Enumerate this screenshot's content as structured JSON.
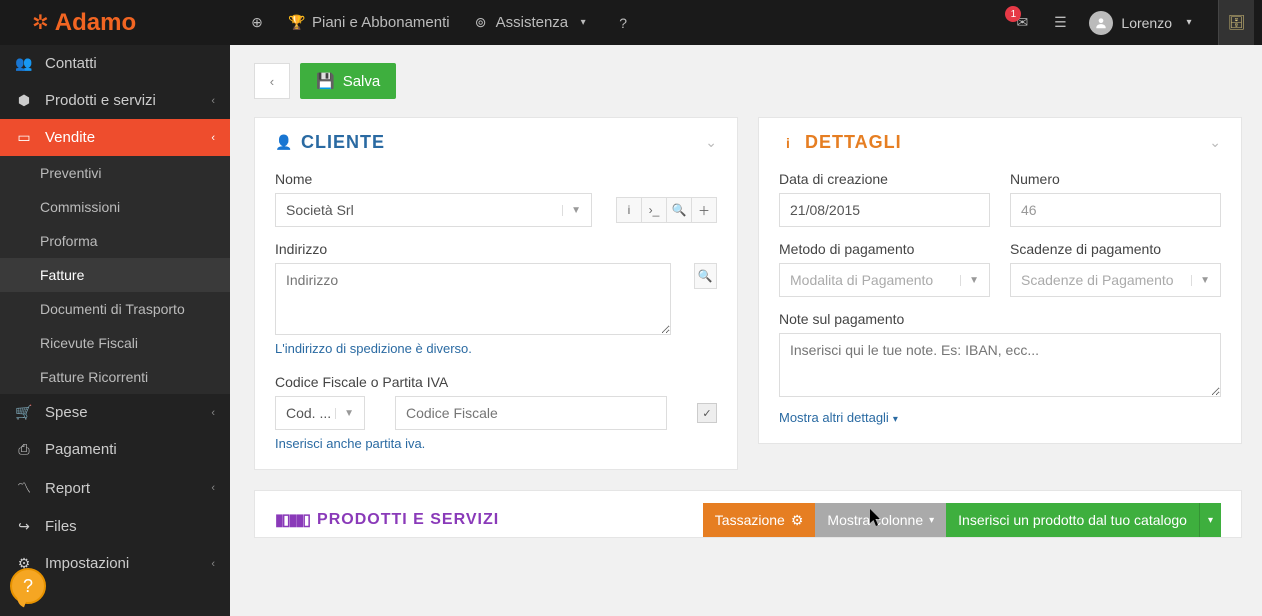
{
  "brand": "Adamo",
  "topnav": {
    "plans": "Piani e Abbonamenti",
    "support": "Assistenza",
    "notifications_count": "1",
    "user_name": "Lorenzo"
  },
  "sidebar": {
    "contatti": "Contatti",
    "prodotti": "Prodotti e servizi",
    "vendite": "Vendite",
    "vendite_sub": {
      "preventivi": "Preventivi",
      "commissioni": "Commissioni",
      "proforma": "Proforma",
      "fatture": "Fatture",
      "ddt": "Documenti di Trasporto",
      "ricevute": "Ricevute Fiscali",
      "fatture_ric": "Fatture Ricorrenti"
    },
    "spese": "Spese",
    "pagamenti": "Pagamenti",
    "report": "Report",
    "files": "Files",
    "impostazioni": "Impostazioni"
  },
  "toolbar": {
    "save": "Salva"
  },
  "cliente": {
    "title": "CLIENTE",
    "nome_label": "Nome",
    "nome_value": "Società Srl",
    "indirizzo_label": "Indirizzo",
    "indirizzo_placeholder": "Indirizzo",
    "spedizione_link": "L'indirizzo di spedizione è diverso.",
    "cf_label": "Codice Fiscale o Partita IVA",
    "cf_select": "Cod. ...",
    "cf_placeholder": "Codice Fiscale",
    "piva_link": "Inserisci anche partita iva."
  },
  "dettagli": {
    "title": "DETTAGLI",
    "data_label": "Data di creazione",
    "data_value": "21/08/2015",
    "numero_label": "Numero",
    "numero_value": "46",
    "metodo_label": "Metodo di pagamento",
    "metodo_placeholder": "Modalita di Pagamento",
    "scadenze_label": "Scadenze di pagamento",
    "scadenze_placeholder": "Scadenze di Pagamento",
    "note_label": "Note sul pagamento",
    "note_placeholder": "Inserisci qui le tue note. Es: IBAN, ecc...",
    "more_link": "Mostra altri dettagli"
  },
  "prodotti": {
    "title": "PRODOTTI E SERVIZI",
    "tassazione": "Tassazione",
    "mostra_colonne": "Mostra colonne",
    "inserisci": "Inserisci un prodotto dal tuo catalogo"
  }
}
